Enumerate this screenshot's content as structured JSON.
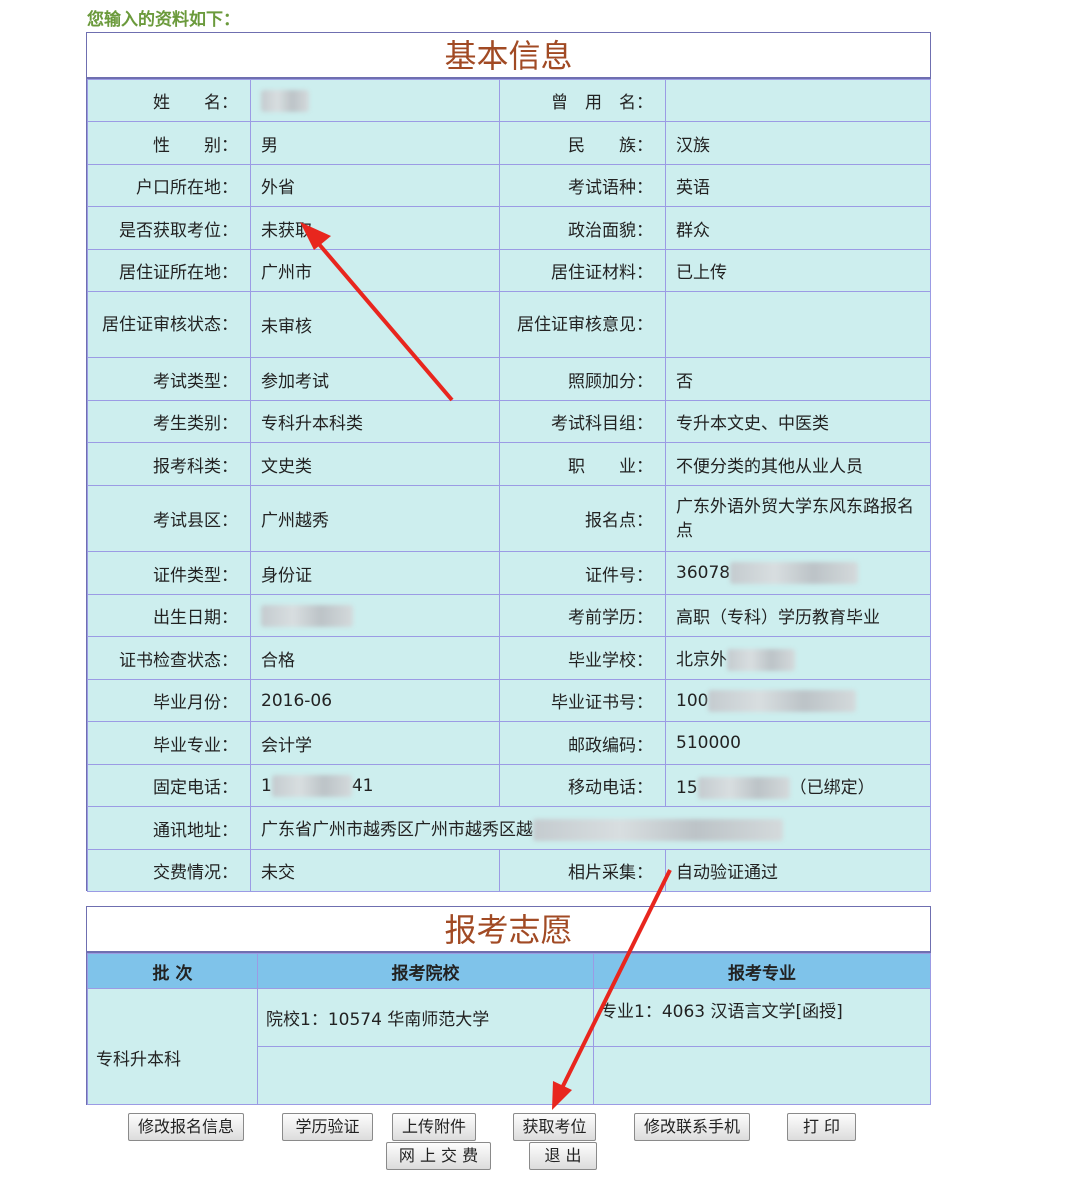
{
  "intro": "您输入的资料如下：",
  "basic": {
    "title": "基本信息",
    "rows": [
      [
        "姓　　名：",
        "",
        "曾　用　名：",
        ""
      ],
      [
        "性　　别：",
        "男",
        "民　　族：",
        "汉族"
      ],
      [
        "户口所在地：",
        "外省",
        "考试语种：",
        "英语"
      ],
      [
        "是否获取考位：",
        "未获取",
        "政治面貌：",
        "群众"
      ],
      [
        "居住证所在地：",
        "广州市",
        "居住证材料：",
        "已上传"
      ],
      [
        "居住证审核状态：",
        "未审核",
        "居住证审核意见：",
        ""
      ],
      [
        "考试类型：",
        "参加考试",
        "照顾加分：",
        " 否"
      ],
      [
        "考生类别：",
        "专科升本科类",
        "考试科目组：",
        "专升本文史、中医类"
      ],
      [
        "报考科类：",
        "文史类",
        "职　　业：",
        "不便分类的其他从业人员"
      ],
      [
        "考试县区：",
        "广州越秀",
        "报名点：",
        "广东外语外贸大学东风东路报名点"
      ],
      [
        "证件类型：",
        "身份证",
        "证件号：",
        "36078"
      ],
      [
        "出生日期：",
        "",
        "考前学历：",
        "高职（专科）学历教育毕业"
      ],
      [
        "证书检查状态：",
        "合格",
        "毕业学校：",
        "北京外"
      ],
      [
        "毕业月份：",
        "2016-06",
        "毕业证书号：",
        "100"
      ],
      [
        "毕业专业：",
        "会计学",
        "邮政编码：",
        "510000"
      ],
      [
        "固定电话：",
        "1",
        "移动电话：",
        "15"
      ],
      [
        "通讯地址：",
        "广东省广州市越秀区广州市越秀区越",
        "",
        ""
      ],
      [
        "交费情况：",
        "未交",
        "相片采集：",
        "自动验证通过"
      ]
    ],
    "fixed_phone_suffix": "41",
    "mobile_suffix": "（已绑定）"
  },
  "wish": {
    "title": "报考志愿",
    "headers": [
      "批 次",
      "报考院校",
      "报考专业"
    ],
    "batch": "专科升本科",
    "school1": "院校1：10574  华南师范大学",
    "major1": "专业1：4063 汉语言文学[函授]"
  },
  "buttons": {
    "modify_info": "修改报名信息",
    "edu_verify": "学历验证",
    "upload": "上传附件",
    "get_seat": "获取考位",
    "modify_phone": "修改联系手机",
    "print": "打 印",
    "pay_online": "网 上 交 费",
    "exit": "退 出"
  },
  "colors": {
    "title": "#a14a24",
    "cell_bg": "#cdeeee",
    "header_bg": "#7fc3ea",
    "border": "#9b9be4",
    "arrow": "#e8261e",
    "intro": "#6b9a3c"
  }
}
